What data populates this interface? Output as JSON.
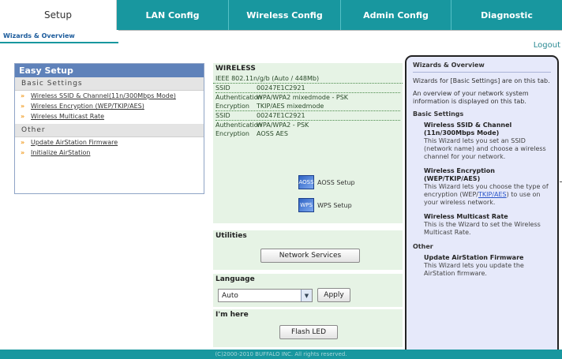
{
  "nav": {
    "tabs": [
      "Setup",
      "LAN Config",
      "Wireless Config",
      "Admin Config",
      "Diagnostic"
    ],
    "active_tab": "Setup",
    "subtab": "Wizards & Overview",
    "logout": "Logout"
  },
  "easy_setup": {
    "title": "Easy Setup",
    "basic_header": "Basic Settings",
    "basic_items": [
      "Wireless SSID & Channel(11n/300Mbps Mode)",
      "Wireless Encryption (WEP/TKIP/AES)",
      "Wireless Multicast Rate"
    ],
    "other_header": "Other",
    "other_items": [
      "Update AirStation Firmware",
      "Initialize AirStation"
    ]
  },
  "wireless": {
    "title": "WIRELESS",
    "first_row": "IEEE 802.11n/g/b (Auto / 448Mb)",
    "rows": [
      {
        "k": "SSID",
        "v": "00247E1C2921"
      },
      {
        "k": "Authentication",
        "v": "WPA/WPA2 mixedmode - PSK"
      },
      {
        "k": "Encryption",
        "v": "TKIP/AES mixedmode"
      },
      {
        "k": "SSID",
        "v": "00247E1C2921"
      },
      {
        "k": "Authentication",
        "v": "WPA/WPA2 - PSK"
      },
      {
        "k": "Encryption",
        "v": "AOSS AES"
      }
    ],
    "aoss_label": "AOSS Setup",
    "aoss_icon": "AOSS",
    "wps_label": "WPS Setup",
    "wps_icon": "WPS"
  },
  "utilities": {
    "title": "Utilities",
    "network_services_button": "Network Services"
  },
  "language": {
    "title": "Language",
    "selected": "Auto",
    "apply_button": "Apply"
  },
  "im_here": {
    "title": "I'm here",
    "flash_button": "Flash LED"
  },
  "help": {
    "title": "Wizards & Overview",
    "intro1": "Wizards for [Basic Settings] are on this tab.",
    "intro2": "An overview of your network system information is displayed on this tab.",
    "basic_header": "Basic Settings",
    "items": [
      {
        "title": "Wireless SSID & Channel (11n/300Mbps Mode)",
        "text": "This Wizard lets you set an SSID (network name) and choose a wireless channel for your network."
      },
      {
        "title": "Wireless Encryption (WEP/TKIP/AES)",
        "text_before": "This Wizard lets you choose the type of encryption (WEP/",
        "text_link": "TKIP/AES",
        "text_after": ") to use on your wireless network."
      },
      {
        "title": "Wireless Multicast Rate",
        "text": "This is the Wizard to set the Wireless Multicast Rate."
      }
    ],
    "other_header": "Other",
    "other_item_title": "Update AirStation Firmware",
    "other_item_text": "This Wizard lets you update the AirStation firmware."
  },
  "footer": {
    "text": "(C)2000-2010 BUFFALO INC. All rights reserved."
  },
  "colors": {
    "nav_teal": "#18979f",
    "easy_header_blue": "#5f82ba",
    "section_green": "#e6f3e5",
    "help_bg": "#e6e9fa",
    "bullet_orange": "#f19a1e"
  }
}
